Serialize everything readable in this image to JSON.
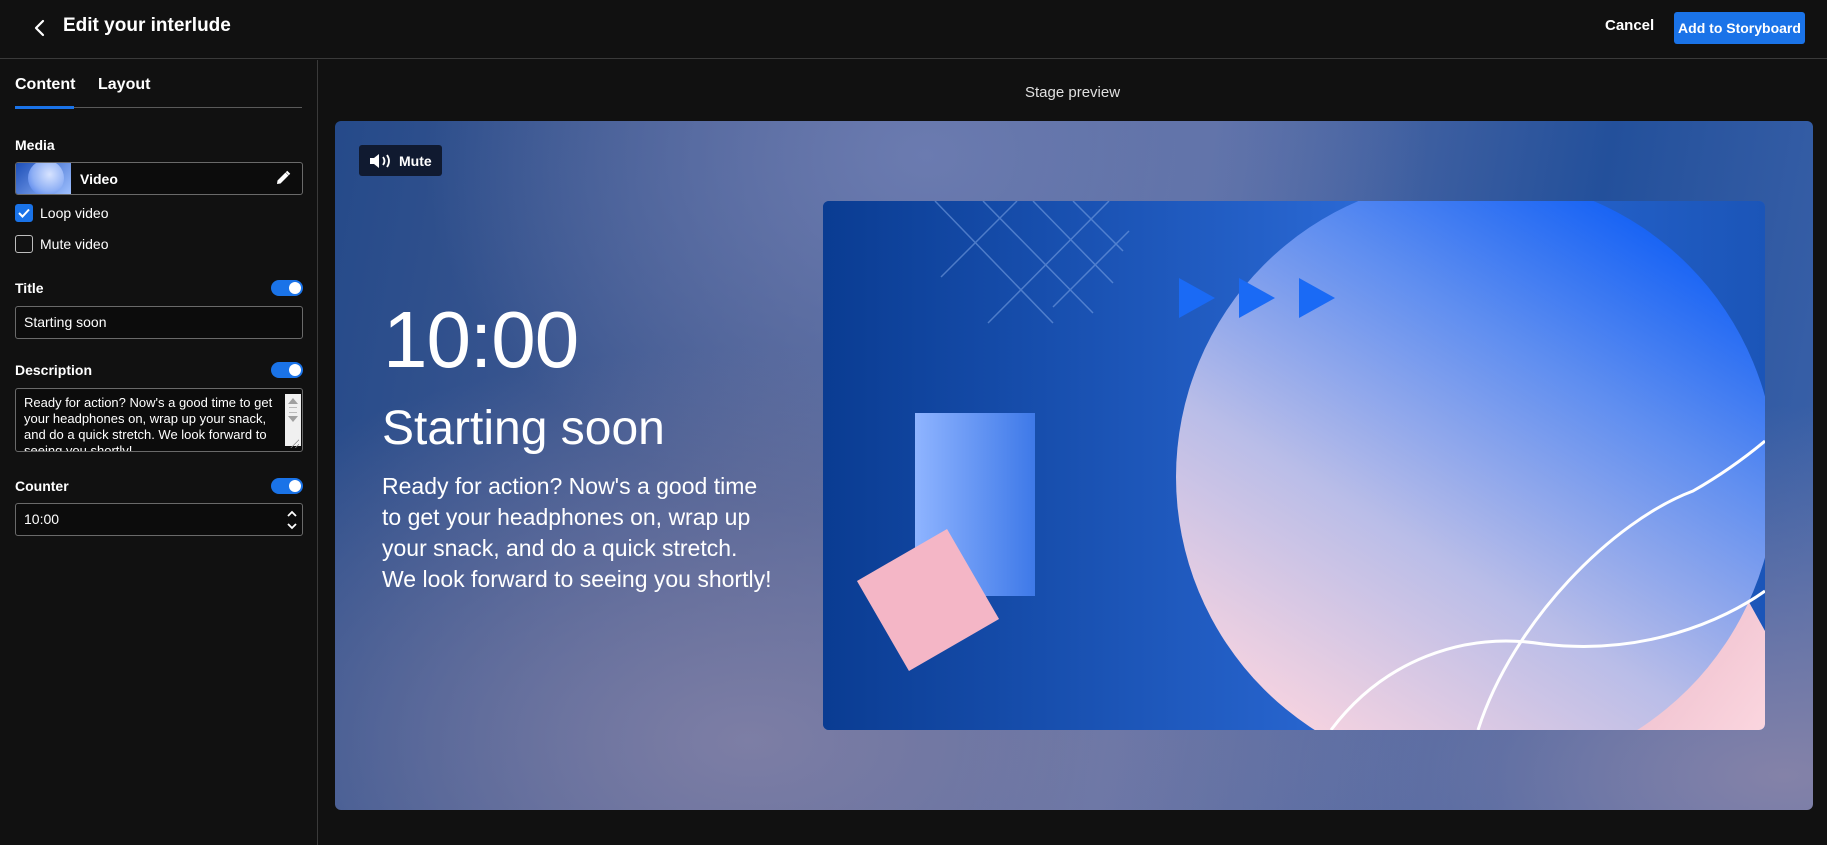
{
  "header": {
    "title": "Edit your interlude",
    "cancel_label": "Cancel",
    "primary_label": "Add to Storyboard"
  },
  "sidebar": {
    "tabs": [
      {
        "label": "Content",
        "active": true
      },
      {
        "label": "Layout",
        "active": false
      }
    ],
    "media": {
      "section_label": "Media",
      "type_label": "Video",
      "loop_label": "Loop video",
      "loop_checked": true,
      "mute_label": "Mute video",
      "mute_checked": false
    },
    "title": {
      "section_label": "Title",
      "enabled": true,
      "value": "Starting soon"
    },
    "description": {
      "section_label": "Description",
      "enabled": true,
      "value": "Ready for action? Now's a good time to get your headphones on, wrap up your snack, and do a quick stretch. We look forward to seeing you shortly!"
    },
    "counter": {
      "section_label": "Counter",
      "enabled": true,
      "value": "10:00"
    }
  },
  "preview": {
    "label": "Stage preview",
    "mute_button_label": "Mute",
    "counter": "10:00",
    "title": "Starting soon",
    "description": "Ready for action? Now's a good time to get your headphones on, wrap up your snack, and do a quick stretch. We look forward to seeing you shortly!"
  },
  "colors": {
    "accent": "#1a73e8",
    "background": "#111111",
    "stage_blue": "#23509b",
    "art_pink": "#f2b5c6"
  },
  "icons": [
    "chevron-left-icon",
    "pencil-icon",
    "checkmark-icon",
    "speaker-icon",
    "stepper-icon",
    "play-icon"
  ]
}
